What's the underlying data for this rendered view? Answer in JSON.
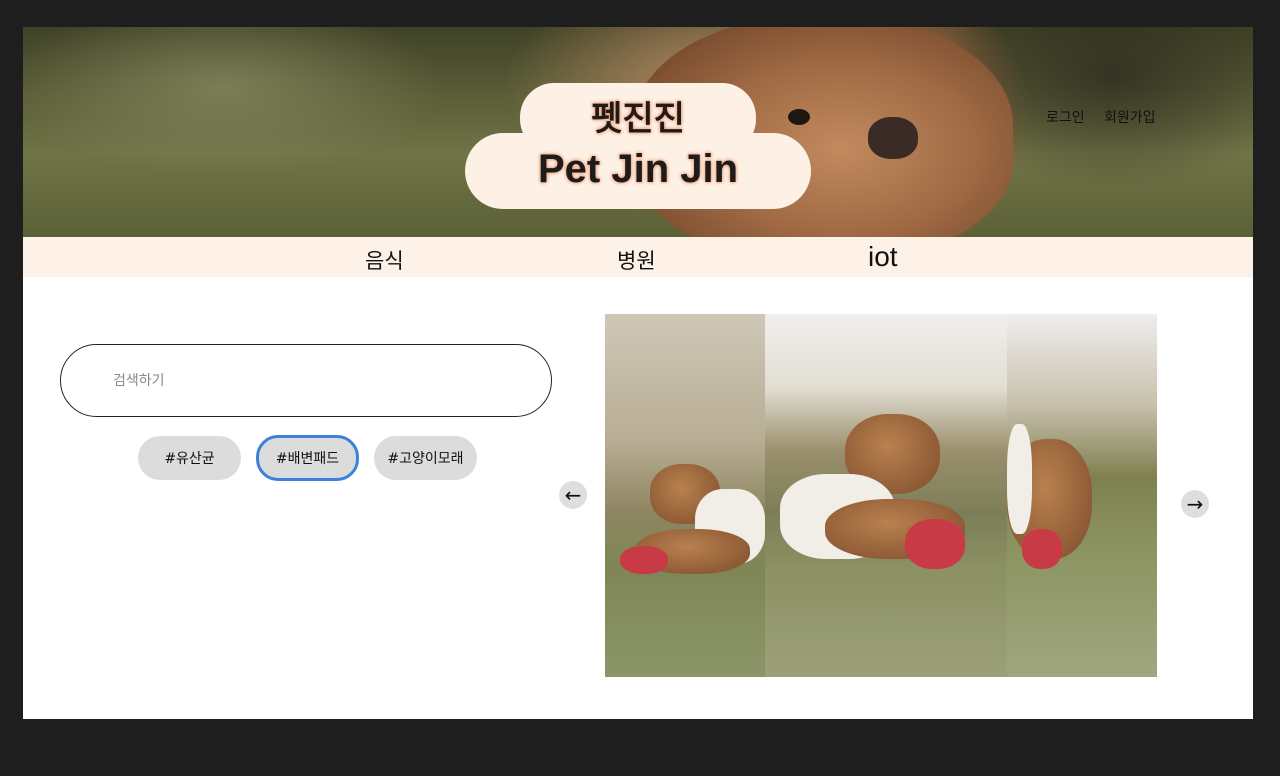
{
  "header": {
    "logo_korean": "펫진진",
    "logo_english": "Pet Jin Jin",
    "login_label": "로그인",
    "signup_label": "회원가입"
  },
  "nav": {
    "items": [
      {
        "label": "음식"
      },
      {
        "label": "병원"
      },
      {
        "label": "iot"
      }
    ]
  },
  "search": {
    "placeholder": "검색하기",
    "value": ""
  },
  "tags": [
    {
      "label": "#유산균",
      "selected": false
    },
    {
      "label": "#배변패드",
      "selected": true
    },
    {
      "label": "#고양이모래",
      "selected": false
    }
  ],
  "carousel": {
    "prev_icon": "arrow-left-icon",
    "next_icon": "arrow-right-icon",
    "prev_glyph": "←",
    "next_glyph": "→"
  },
  "colors": {
    "background": "#1e1e1e",
    "page": "#ffffff",
    "nav_bg": "#fdf1e8",
    "logo_bg": "#fdf1e6",
    "logo_glow": "#f2a07a",
    "tag_bg": "#dcdcdc",
    "tag_selected_border": "#3c82dc"
  }
}
